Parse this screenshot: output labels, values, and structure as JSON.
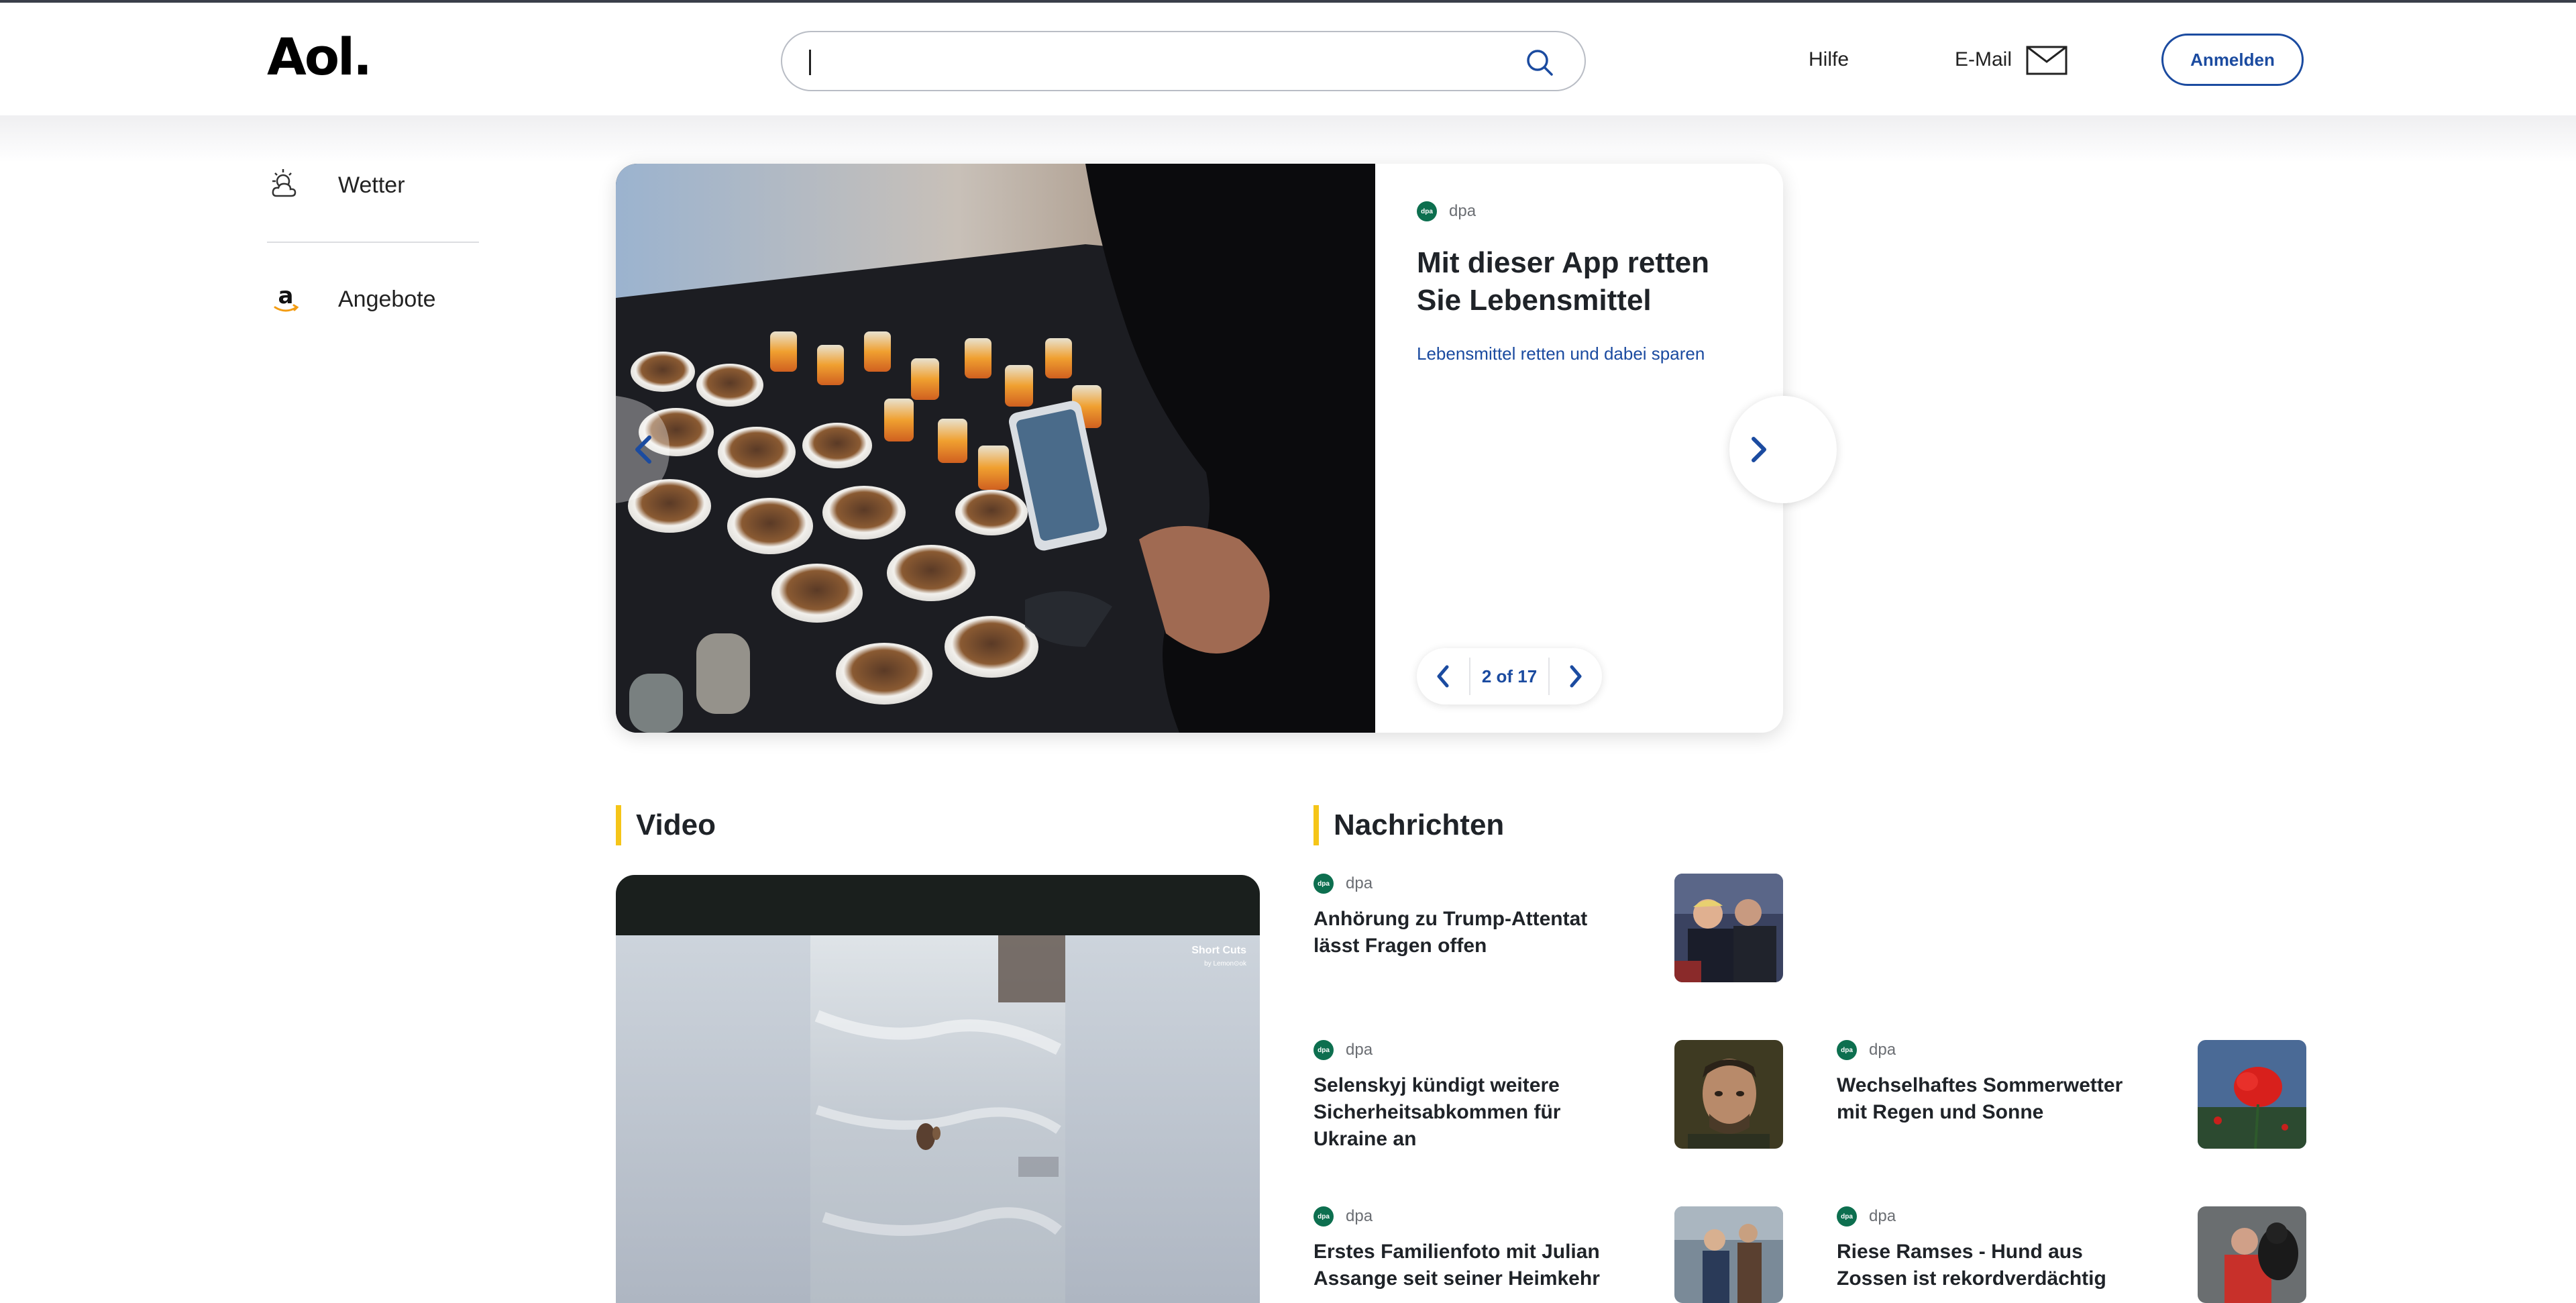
{
  "header": {
    "logo": "Aol.",
    "search": {
      "value": "",
      "placeholder": ""
    },
    "help": "Hilfe",
    "mail": "E-Mail",
    "signin": "Anmelden"
  },
  "sidebar": {
    "items": [
      {
        "label": "Wetter",
        "icon": "weather-icon"
      },
      {
        "label": "Angebote",
        "icon": "amazon-icon"
      }
    ]
  },
  "hero": {
    "source": "dpa",
    "title": "Mit dieser App retten Sie Lebensmittel",
    "subtitle": "Lebensmittel retten und dabei sparen",
    "pager": "2 of 17"
  },
  "video": {
    "section_title": "Video",
    "brand": "Short Cuts",
    "brand_sub": "by Lemon⊙ok"
  },
  "news": {
    "section_title": "Nachrichten",
    "items": [
      {
        "source": "dpa",
        "headline": "Anhörung zu Trump-Attentat lässt Fragen offen"
      },
      {
        "source": "dpa",
        "headline": "Selenskyj kündigt weitere Sicherheitsabkommen für Ukraine an"
      },
      {
        "source": "dpa",
        "headline": "Wechselhaftes Sommerwetter mit Regen und Sonne"
      },
      {
        "source": "dpa",
        "headline": "Erstes Familienfoto mit Julian Assange seit seiner Heimkehr"
      },
      {
        "source": "dpa",
        "headline": "Riese Ramses - Hund aus Zossen ist rekordverdächtig"
      }
    ]
  },
  "colors": {
    "accent_blue": "#1b4ba0",
    "section_bar": "#f5c518",
    "dpa_green": "#0d6f4f"
  }
}
